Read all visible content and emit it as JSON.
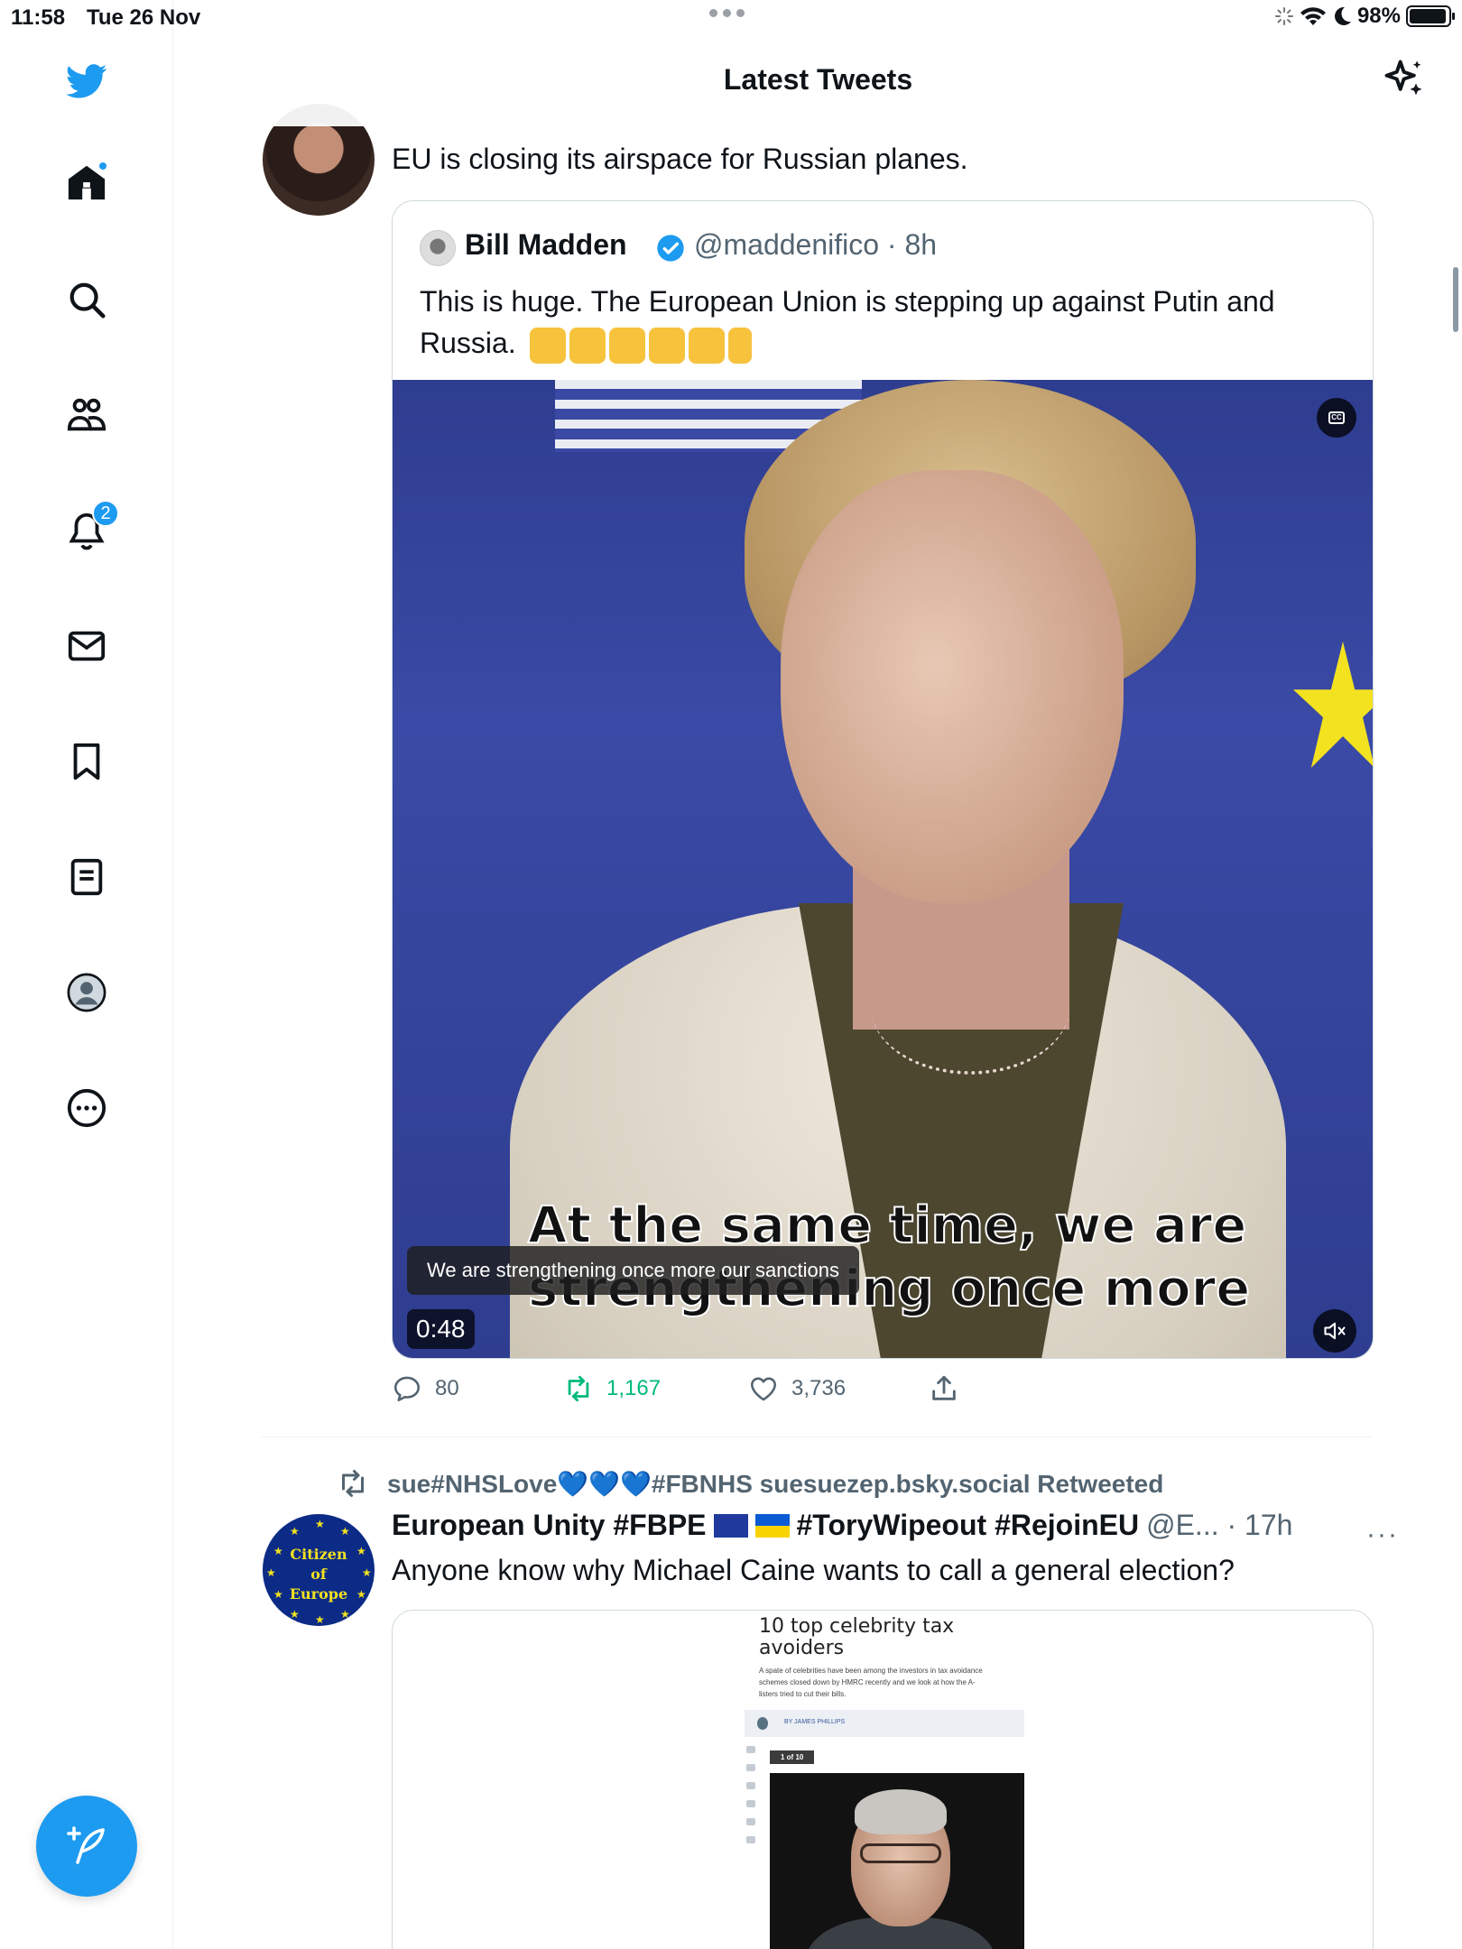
{
  "status_bar": {
    "time": "11:58",
    "date": "Tue 26 Nov",
    "battery_pct": "98%"
  },
  "colors": {
    "brand": "#1d9bf0",
    "retweet": "#00ba7c",
    "text": "#0f1419",
    "muted": "#536471",
    "border": "#cfd9de"
  },
  "sidebar": {
    "items": [
      {
        "icon": "twitter-bird-icon"
      },
      {
        "icon": "home-icon",
        "has_dot": true
      },
      {
        "icon": "search-icon"
      },
      {
        "icon": "communities-icon"
      },
      {
        "icon": "notifications-icon",
        "badge": "2"
      },
      {
        "icon": "messages-icon"
      },
      {
        "icon": "bookmarks-icon"
      },
      {
        "icon": "lists-icon"
      },
      {
        "icon": "profile-icon"
      },
      {
        "icon": "more-icon"
      }
    ],
    "compose_icon": "compose-tweet-icon"
  },
  "header": {
    "title": "Latest Tweets",
    "right_icon": "sparkle-icon"
  },
  "tweets": [
    {
      "text": "EU is closing its airspace for Russian planes.",
      "quote": {
        "name": "Bill Madden",
        "handle": "@maddenifico · 8h",
        "text": "This is huge. The European Union is stepping up against Putin and Russia.",
        "emojis": [
          "raising-hands-emoji",
          "folded-hands-emoji",
          "flexed-biceps-emoji",
          "clapping-hands-emoji",
          "oncoming-fist-emoji",
          "pointing-down-emoji"
        ],
        "video": {
          "burned_caption_line1": "At the same time, we are",
          "burned_caption_line2": "strengthening once more",
          "caption": "We are strengthening once more our sanctions",
          "duration": "0:48",
          "cc_label": "CC"
        }
      },
      "actions": {
        "replies": "80",
        "retweets": "1,167",
        "likes": "3,736"
      }
    },
    {
      "retweeted_by": "sue#NHSLove💙💙💙#FBNHS suesuezep.bsky.social Retweeted",
      "name_part1": "European Unity #FBPE",
      "name_part2": "#ToryWipeout #RejoinEU",
      "handle": "@E... · 17h",
      "more": "···",
      "text": "Anyone know why Michael Caine wants to call a general election?",
      "avatar_text": [
        "Citizen",
        "of",
        "Europe"
      ],
      "card": {
        "title": "10 top celebrity tax avoiders",
        "subtitle": "A spate of celebrities have been among the investors in tax avoidance schemes closed down by HMRC recently and we look at how the A-listers tried to cut their bills.",
        "byline": "BY JAMES PHILLIPS",
        "counter": "1 of 10"
      }
    }
  ]
}
